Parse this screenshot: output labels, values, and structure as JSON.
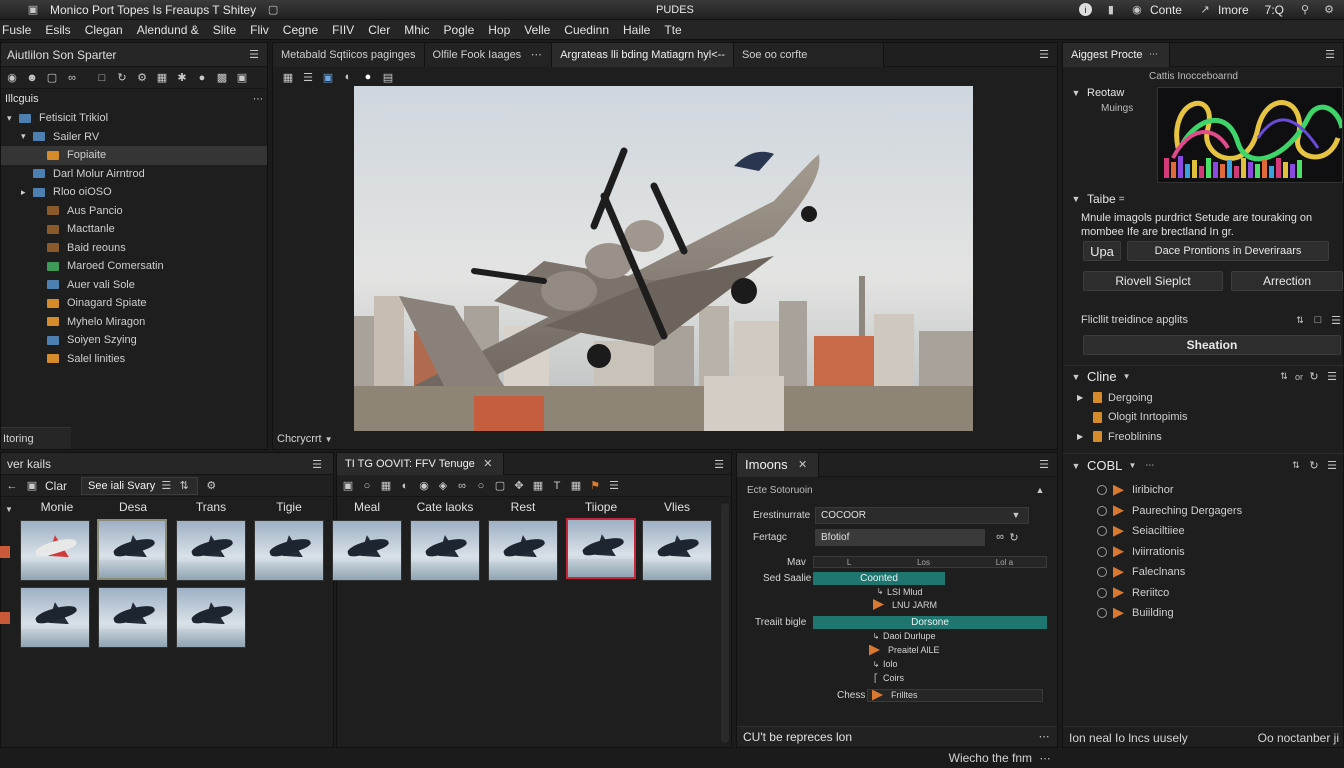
{
  "titlebar": {
    "app_title": "Monico Port Topes Is  Freaups  T Shitey",
    "center": "PUDES",
    "right": [
      "Conte",
      "Imore",
      "7:Q"
    ]
  },
  "menu": [
    "Fusle",
    "Esils",
    "Clegan",
    "Alendund &",
    "Slite",
    "Fliv",
    "Cegne",
    "FIIV",
    "Cler",
    "Mhic",
    "Pogle",
    "Hop",
    "Velle",
    "Cuedinn",
    "Haile",
    "Tte"
  ],
  "left_panel": {
    "title": "Aiutlilon Son Sparter",
    "section": "Illcguis",
    "tree": [
      {
        "label": "Fetisicit Trikiol",
        "level": 0,
        "arrow": "▾",
        "folder": "blue"
      },
      {
        "label": "Sailer RV",
        "level": 1,
        "arrow": "▾",
        "folder": "blue"
      },
      {
        "label": "Fopiaite",
        "level": 2,
        "arrow": "",
        "folder": "orange",
        "selected": true
      },
      {
        "label": "Darl Molur Airntrod",
        "level": 1,
        "arrow": "",
        "folder": "blue"
      },
      {
        "label": "Rloo oiOSO",
        "level": 1,
        "arrow": "▸",
        "folder": "blue"
      },
      {
        "label": "Aus Pancio",
        "level": 2,
        "arrow": "",
        "folder": "brown"
      },
      {
        "label": "Macttanle",
        "level": 2,
        "arrow": "",
        "folder": "brown"
      },
      {
        "label": "Baid reouns",
        "level": 2,
        "arrow": "",
        "folder": "brown"
      },
      {
        "label": "Maroed Comersatin",
        "level": 2,
        "arrow": "",
        "folder": "green"
      },
      {
        "label": "Auer vali Sole",
        "level": 2,
        "arrow": "",
        "folder": "blue"
      },
      {
        "label": "Oinagard Spiate",
        "level": 2,
        "arrow": "",
        "folder": "orange"
      },
      {
        "label": "Myhelo Miragon",
        "level": 2,
        "arrow": "",
        "folder": "orange"
      },
      {
        "label": "Soiyen Szying",
        "level": 2,
        "arrow": "",
        "folder": "blue"
      },
      {
        "label": "Salel linities",
        "level": 2,
        "arrow": "",
        "folder": "orange"
      }
    ],
    "footer_tab": "Itoring"
  },
  "viewer": {
    "tabs": [
      "Metabald Sqtiicos paginges",
      "Olfile Fook Iaages",
      "Argrateas lli bding Matiagrn hyl<--",
      "Soe oo corfte"
    ],
    "footer_label": "Chcrycrrt"
  },
  "bottom_left": {
    "title": "ver kails",
    "search_placeholder": "Clar",
    "search_label": "See iali Svary",
    "columns": [
      "Monie",
      "Desa",
      "Trans",
      "Tigie",
      "Meal",
      "Cate laoks",
      "Rest",
      "Tiiope",
      "Vlies"
    ]
  },
  "bottom_mid_tab": "TI TG OOVIT: FFV  Tenuge",
  "inspector": {
    "title": "Imoons",
    "subtitle": "Ecte Sotoruoin",
    "rows": [
      {
        "label": "Erestinurrate",
        "value": "COCOOR"
      },
      {
        "label": "Fertagc",
        "value": "Bfotiof"
      }
    ],
    "ruler_label": "Mav",
    "ruler_ticks": [
      "L",
      "Los",
      "Lol a"
    ],
    "track1_label": "Sed Saalie",
    "track1_value": "Coonted",
    "track1_items": [
      "LSI Mlud",
      "LNU JARM"
    ],
    "track2_label": "Treaiit bigle",
    "track2_value": "Dorsone",
    "track2_items": [
      "Daoi Durlupe",
      "Preaitel AlLE",
      "Iolo",
      "Coirs"
    ],
    "chess_label": "Chess",
    "chess_value": "Frilltes",
    "footer": "CU't be repreces lon",
    "status": "Wiecho the fnm"
  },
  "right_panel": {
    "title": "Aiggest Procte",
    "preview_label": "Cattis Inocceboarnd",
    "group1": "Reotaw",
    "group1_sub": "Muings",
    "section_table": "Taibe",
    "desc": "Mnule imagols purdrict Setude are touraking on mombee Ife are brectland In gr.",
    "btn_upa": "Upa",
    "btn_dace": "Dace Prontions in Deveriraars",
    "btn_riovell": "Riovell Sieplct",
    "btn_arrection": "Arrection",
    "flicit_label": "Flicllit treidince apglits",
    "btn_sheation": "Sheation",
    "cline_title": "Cline",
    "cline_items": [
      "Dergoing",
      "Ologit Inrtopimis",
      "Freoblinins"
    ],
    "cobl_title": "COBL",
    "cobl_items": [
      "Iiribichor",
      "Paureching Dergagers",
      "Seiaciltiiee",
      "Iviirrationis",
      "Faleclnans",
      "Reriitco",
      "Buiilding"
    ],
    "status_left": "Ion neal Io lncs uusely",
    "status_right": "Oo noctanber ji"
  }
}
